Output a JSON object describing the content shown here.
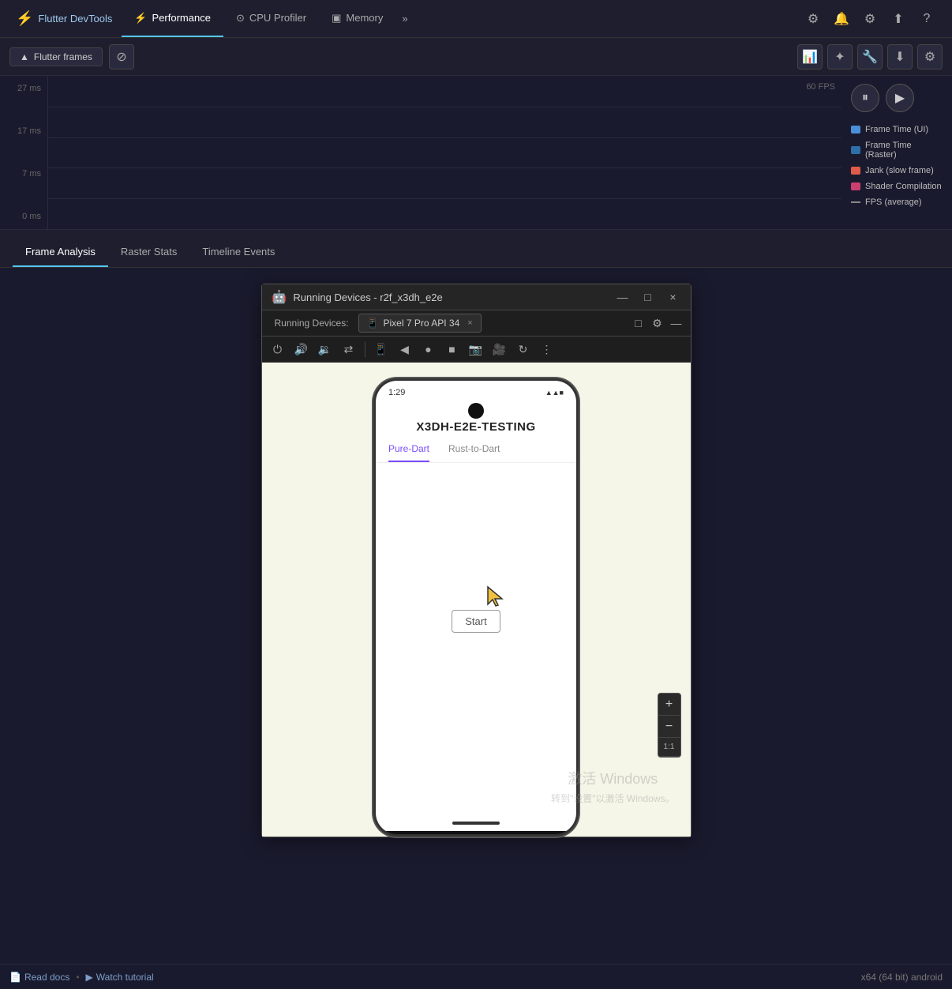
{
  "app": {
    "brand": "Flutter DevTools",
    "brand_icon": "⚡"
  },
  "nav": {
    "tabs": [
      {
        "id": "devtools",
        "label": "Flutter DevTools",
        "icon": "🏠",
        "active": false,
        "is_brand": true
      },
      {
        "id": "performance",
        "label": "Performance",
        "icon": "⚡",
        "active": true
      },
      {
        "id": "cpu_profiler",
        "label": "CPU Profiler",
        "icon": "⊙",
        "active": false
      },
      {
        "id": "memory",
        "label": "Memory",
        "icon": "▣",
        "active": false
      }
    ],
    "more_icon": "»",
    "actions": [
      {
        "id": "settings1",
        "icon": "⚙",
        "label": "Settings"
      },
      {
        "id": "notify",
        "icon": "🔔",
        "label": "Notifications"
      },
      {
        "id": "settings2",
        "icon": "⚙",
        "label": "DevTools Settings"
      },
      {
        "id": "upload",
        "icon": "⬆",
        "label": "Upload"
      },
      {
        "id": "help",
        "icon": "?",
        "label": "Help"
      }
    ]
  },
  "toolbar": {
    "flutter_frames_label": "Flutter frames",
    "flutter_frames_icon": "▲",
    "clear_icon": "⊘",
    "chart_icon": "📊",
    "enhance_icon": "✦",
    "wrench_icon": "🔧",
    "download_icon": "⬇",
    "settings_icon": "⚙"
  },
  "chart": {
    "y_labels": [
      "27 ms",
      "17 ms",
      "7 ms",
      "0 ms"
    ],
    "fps_label": "60 FPS",
    "legend": [
      {
        "id": "frame_time_ui",
        "label": "Frame Time (UI)",
        "color": "#4a90d9",
        "type": "box"
      },
      {
        "id": "frame_time_raster",
        "label": "Frame Time (Raster)",
        "color": "#2d6fa8",
        "type": "box"
      },
      {
        "id": "jank",
        "label": "Jank (slow frame)",
        "color": "#e05c4a",
        "type": "box"
      },
      {
        "id": "shader",
        "label": "Shader Compilation",
        "color": "#c94070",
        "type": "box"
      },
      {
        "id": "fps_avg",
        "label": "FPS (average)",
        "color": "#888888",
        "type": "dash"
      }
    ],
    "pause_icon": "⏸",
    "play_icon": "▶"
  },
  "tabs": {
    "items": [
      {
        "id": "frame_analysis",
        "label": "Frame Analysis",
        "active": true
      },
      {
        "id": "raster_stats",
        "label": "Raster Stats",
        "active": false
      },
      {
        "id": "timeline_events",
        "label": "Timeline Events",
        "active": false
      }
    ]
  },
  "device_window": {
    "icon": "🤖",
    "title": "Running Devices - r2f_x3dh_e2e",
    "minimize_icon": "—",
    "maximize_icon": "□",
    "close_icon": "×",
    "tab": {
      "device_icon": "📱",
      "label": "Pixel 7 Pro API 34",
      "close_icon": "×"
    },
    "tab_actions": [
      {
        "id": "layout",
        "icon": "□"
      },
      {
        "id": "settings",
        "icon": "⚙"
      },
      {
        "id": "minimize",
        "icon": "—"
      }
    ],
    "toolbar_icons": [
      "⏻",
      "🔊",
      "🔉",
      "⇄",
      "📱",
      "◀",
      "●",
      "■",
      "📷",
      "🎥",
      "↻",
      "⋮"
    ]
  },
  "emulator": {
    "status_bar_time": "1:29",
    "status_bar_icons": "▲ ↑",
    "status_bar_right": "▲ ▲ ■",
    "app_title": "X3DH-E2E-TESTING",
    "tabs": [
      {
        "label": "Pure-Dart",
        "active": true
      },
      {
        "label": "Rust-to-Dart",
        "active": false
      }
    ],
    "start_button": "Start"
  },
  "zoom": {
    "plus": "+",
    "minus": "−",
    "ratio": "1:1"
  },
  "watermark": {
    "line1": "激活 Windows",
    "line2": "转到\"设置\"以激活 Windows。"
  },
  "status_bar": {
    "read_docs_icon": "📄",
    "read_docs": "Read docs",
    "watch_tutorial_icon": "▶",
    "watch_tutorial": "Watch tutorial",
    "dot": "•",
    "platform": "x64 (64 bit) android"
  }
}
